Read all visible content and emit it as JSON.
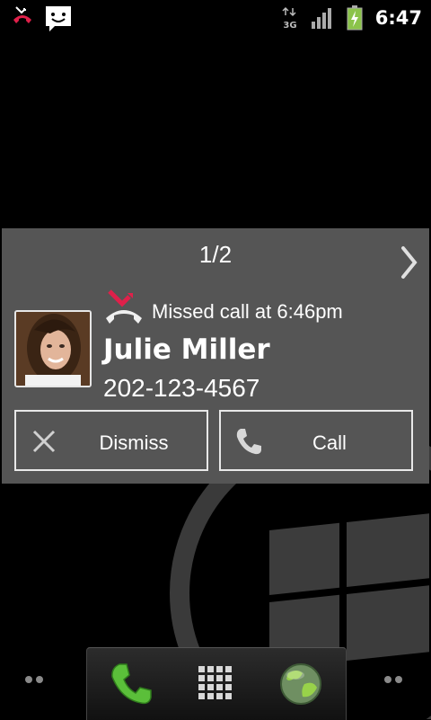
{
  "status_bar": {
    "time": "6:47",
    "network": "3G",
    "icons": [
      "missed-call-icon",
      "sms-icon",
      "data-3g-icon",
      "signal-icon",
      "battery-charging-icon"
    ]
  },
  "notification": {
    "pager": "1/2",
    "missed_text": "Missed call at 6:46pm",
    "caller_name": "Julie Miller",
    "caller_number": "202-123-4567",
    "dismiss_label": "Dismiss",
    "call_label": "Call",
    "colors": {
      "card_bg": "#555555",
      "missed_accent": "#e0204a"
    }
  },
  "dock": {
    "items": [
      "phone-icon",
      "app-drawer-icon",
      "browser-globe-icon"
    ]
  }
}
